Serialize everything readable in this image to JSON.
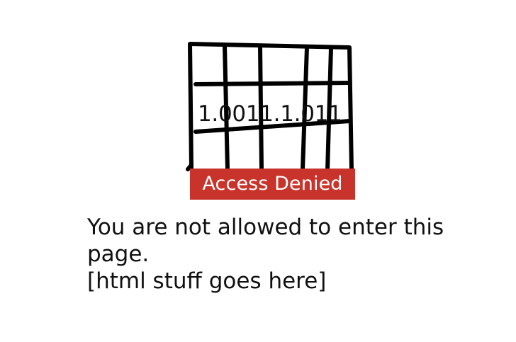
{
  "illustration": {
    "id_text": "1.0011.1.011",
    "icon": "barred-gate-icon"
  },
  "banner": {
    "label": "Access Denied",
    "color": "#c8332b"
  },
  "message": {
    "line1": "You are not allowed to enter this",
    "line2": "page.",
    "line3": "[html stuff goes here]"
  }
}
